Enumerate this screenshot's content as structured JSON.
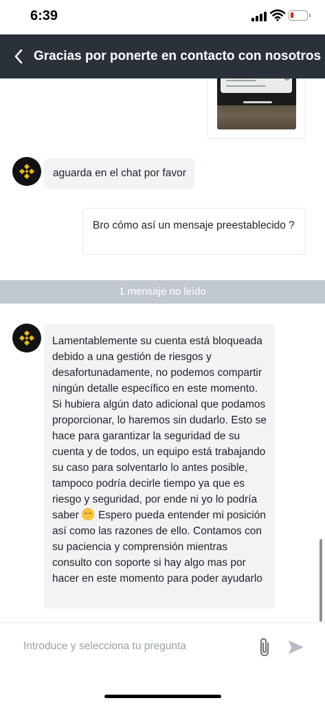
{
  "status_bar": {
    "time": "6:39"
  },
  "header": {
    "title": "Gracias por ponerte en contacto con nosotros",
    "color": "#2b3139"
  },
  "messages": [
    {
      "from": "agent",
      "text": "aguarda en el chat por favor"
    },
    {
      "from": "user",
      "text": "Bro cómo así un mensaje preestablecido ?"
    },
    {
      "from": "agent",
      "text_before_emoji": "Lamentablemente su cuenta está bloqueada debido a una gestión de riesgos y desafortunadamente, no podemos compartir ningún detalle específico en este momento. Si hubiera algún dato adicional que podamos proporcionar, lo haremos sin dudarlo. Esto se hace para garantizar la seguridad de su cuenta y de todos, un equipo está trabajando su caso para solventarlo lo antes posible, tampoco podría decirle tiempo ya que es riesgo y seguridad, por ende ni yo lo podría saber",
      "emoji": "pensive-face",
      "text_after_emoji": "Espero pueda entender mi posición así como las razones de ello. Contamos con su paciencia y comprensión mientras consulto con soporte si hay algo mas por hacer en este momento para poder ayudarlo"
    }
  ],
  "unread_divider": "1 mensaje no leído",
  "input": {
    "placeholder": "Introduce y selecciona tu pregunta",
    "value": ""
  },
  "icons": {
    "back": "chevron-left-icon",
    "attach": "paperclip-icon",
    "send": "send-icon",
    "avatar": "binance-logo-icon"
  },
  "colors": {
    "brand": "#f0b90b",
    "incoming_bubble": "#f2f3f4",
    "unread_bar": "#c2c8cf",
    "battery_low": "#e0251b"
  }
}
